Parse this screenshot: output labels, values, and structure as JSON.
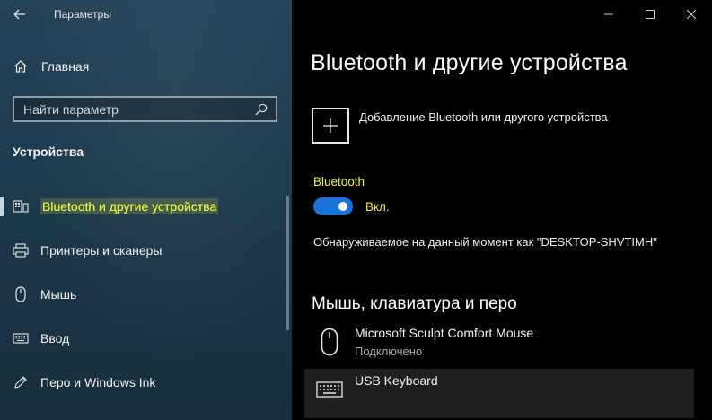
{
  "window": {
    "app_title": "Параметры"
  },
  "sidebar": {
    "home_label": "Главная",
    "search_placeholder": "Найти параметр",
    "section_heading": "Устройства",
    "items": [
      {
        "label": "Bluetooth и другие устройства",
        "icon": "bluetooth-devices-icon",
        "active": true
      },
      {
        "label": "Принтеры и сканеры",
        "icon": "printer-icon",
        "active": false
      },
      {
        "label": "Мышь",
        "icon": "mouse-icon",
        "active": false
      },
      {
        "label": "Ввод",
        "icon": "keyboard-icon",
        "active": false
      },
      {
        "label": "Перо и Windows Ink",
        "icon": "pen-icon",
        "active": false
      }
    ]
  },
  "main": {
    "page_title": "Bluetooth и другие устройства",
    "add_device_label": "Добавление Bluetooth или другого устройства",
    "bluetooth_label": "Bluetooth",
    "bluetooth_toggle_state": "Вкл.",
    "bluetooth_on": true,
    "discoverable_text": "Обнаруживаемое на данный момент как \"DESKTOP-SHVTIMH\"",
    "section_title": "Мышь, клавиатура и перо",
    "devices": [
      {
        "name": "Microsoft Sculpt Comfort Mouse",
        "status": "Подключено",
        "icon": "mouse-icon"
      },
      {
        "name": "USB Keyboard",
        "status": "",
        "icon": "keyboard-icon"
      }
    ]
  },
  "colors": {
    "accent_blue": "#1a73d8",
    "highlight_yellow": "#f0ee3c",
    "sidebar_bg": "#1f3b4f"
  }
}
